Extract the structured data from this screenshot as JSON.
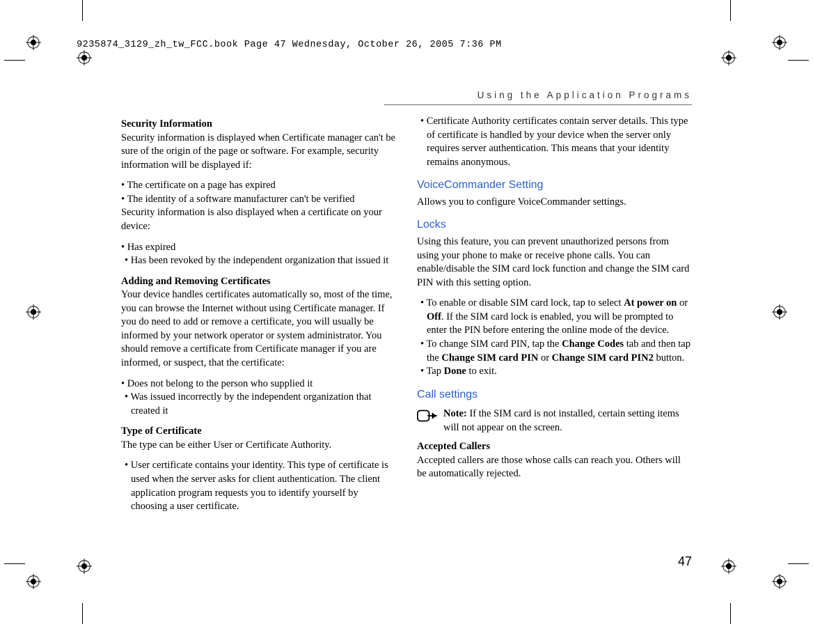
{
  "meta": {
    "book_header": "9235874_3129_zh_tw_FCC.book  Page 47  Wednesday, October 26, 2005  7:36 PM",
    "page_running_head": "Using the Application Programs",
    "page_number": "47"
  },
  "left": {
    "sec_info_head": "Security Information",
    "sec_info_para": "Security information is displayed when Certificate manager can't be sure of the origin of the page or software. For example, security information will be displayed if:",
    "sec_info_b1": "• The certificate on a page has expired",
    "sec_info_b2": "• The identity of a software manufacturer can't be verified",
    "sec_info_after": "Security information is also displayed when a certificate on your device:",
    "sec_info_b3": "• Has expired",
    "sec_info_b4": "• Has been revoked by the independent organization that issued it",
    "addrem_head": "Adding and Removing Certificates",
    "addrem_para": "Your device handles certificates automatically so, most of the time, you can browse the Internet without using Certificate manager. If you do need to add or remove a certificate, you will usually be informed by your network operator or system administrator. You should remove a certificate from Certificate manager if you are informed, or suspect, that the certificate:",
    "addrem_b1": "• Does not belong to the person who supplied it",
    "addrem_b2": "• Was issued incorrectly by the independent organization that created it",
    "type_head": "Type of Certificate",
    "type_para": "The type can be either User or Certificate Authority.",
    "type_b1": "• User certificate contains your identity. This type of certificate is used when the server asks for client authentication. The client application program requests you to identify yourself by choosing a user certificate."
  },
  "right": {
    "ca_b1": "• Certificate Authority certificates contain server details. This type of certificate is handled by your device when the server only requires server authentication. This means that your identity remains anonymous.",
    "vc_title": "VoiceCommander Setting",
    "vc_para": "Allows you to configure VoiceCommander settings.",
    "locks_title": "Locks",
    "locks_para": "Using this feature, you can prevent unauthorized persons from using your phone to make or receive phone calls. You can enable/disable the SIM card lock function and change the SIM card PIN with this setting option.",
    "locks_b1_pre": "• To enable or disable SIM card lock, tap to select ",
    "locks_b1_bold1": "At power on",
    "locks_b1_mid1": " or ",
    "locks_b1_bold2": "Off",
    "locks_b1_post": ". If the SIM card lock is enabled, you will be prompted to enter the PIN before entering the online mode of the device.",
    "locks_b2_pre": "• To change SIM card PIN, tap the ",
    "locks_b2_bold1": "Change Codes",
    "locks_b2_mid1": " tab and then tap the ",
    "locks_b2_bold2": "Change SIM card PIN",
    "locks_b2_mid2": " or ",
    "locks_b2_bold3": "Change SIM card PIN2",
    "locks_b2_post": " button.",
    "locks_b3_pre": "• Tap ",
    "locks_b3_bold": "Done",
    "locks_b3_post": " to exit.",
    "call_title": "Call settings",
    "note_bold": "Note:",
    "note_text": " If the SIM card is not installed, certain setting items will not appear on the screen.",
    "accepted_head": "Accepted Callers",
    "accepted_para": "Accepted callers are those whose calls can reach you. Others will be automatically rejected."
  }
}
